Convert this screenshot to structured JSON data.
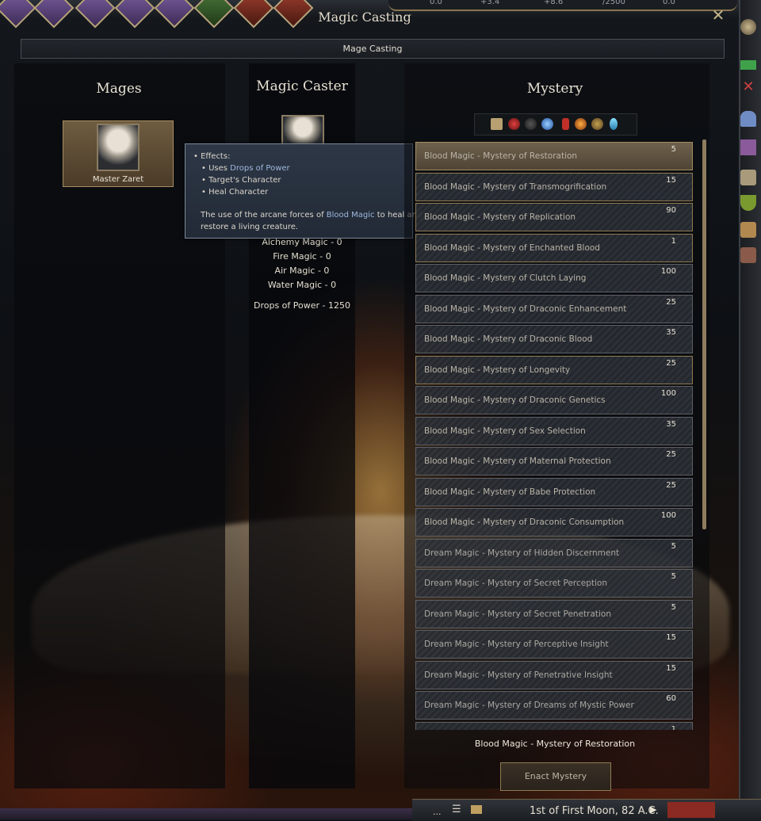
{
  "window": {
    "title": "Magic Casting",
    "subtitle": "Mage Casting",
    "close": "✕"
  },
  "resources": [
    "0.0",
    "+3.4",
    "+8.6",
    "/2500",
    "0.0"
  ],
  "mages": {
    "header": "Mages",
    "list": [
      {
        "name": "Master Zaret"
      }
    ]
  },
  "caster": {
    "header": "Magic Caster",
    "stats": [
      "Alchemy Magic - 0",
      "Fire Magic - 0",
      "Air Magic - 0",
      "Water Magic - 0"
    ],
    "drops": "Drops of Power - 1250"
  },
  "tooltip": {
    "effects_label": "• Effects:",
    "uses_prefix": "• Uses ",
    "uses_value": "Drops of Power",
    "line2": "• Target's Character",
    "line3": "• Heal Character",
    "desc_prefix": "The use of the arcane forces of ",
    "desc_highlight": "Blood Magic",
    "desc_suffix": " to heal and",
    "desc_line2": "restore a living creature."
  },
  "mystery": {
    "header": "Mystery",
    "items": [
      {
        "name": "Blood Magic - Mystery of Restoration",
        "cost": "5"
      },
      {
        "name": "Blood Magic - Mystery of Transmogrification",
        "cost": "15"
      },
      {
        "name": "Blood Magic - Mystery of Replication",
        "cost": "90"
      },
      {
        "name": "Blood Magic - Mystery of Enchanted Blood",
        "cost": "1"
      },
      {
        "name": "Blood Magic - Mystery of Clutch Laying",
        "cost": "100"
      },
      {
        "name": "Blood Magic - Mystery of Draconic Enhancement",
        "cost": "25"
      },
      {
        "name": "Blood Magic - Mystery of Draconic Blood",
        "cost": "35"
      },
      {
        "name": "Blood Magic - Mystery of Longevity",
        "cost": "25"
      },
      {
        "name": "Blood Magic - Mystery of Draconic Genetics",
        "cost": "100"
      },
      {
        "name": "Blood Magic - Mystery of Sex Selection",
        "cost": "35"
      },
      {
        "name": "Blood Magic - Mystery of Maternal Protection",
        "cost": "25"
      },
      {
        "name": "Blood Magic - Mystery of Babe Protection",
        "cost": "25"
      },
      {
        "name": "Blood Magic - Mystery of Draconic Consumption",
        "cost": "100"
      },
      {
        "name": "Dream Magic - Mystery of Hidden Discernment",
        "cost": "5"
      },
      {
        "name": "Dream Magic - Mystery of Secret Perception",
        "cost": "5"
      },
      {
        "name": "Dream Magic - Mystery of Secret Penetration",
        "cost": "5"
      },
      {
        "name": "Dream Magic - Mystery of Perceptive Insight",
        "cost": "15"
      },
      {
        "name": "Dream Magic - Mystery of Penetrative Insight",
        "cost": "15"
      },
      {
        "name": "Dream Magic - Mystery of Dreams of Mystic Power",
        "cost": "60"
      },
      {
        "name": "",
        "cost": "1"
      }
    ],
    "selected": "Blood Magic - Mystery of Restoration",
    "enact_label": "Enact Mystery",
    "school_icons": [
      "book-icon",
      "blood-drop-icon",
      "dark-orb-icon",
      "water-orb-icon",
      "fire-flask-icon",
      "fire-orb-icon",
      "earth-orb-icon",
      "air-crystal-icon"
    ]
  },
  "footer": {
    "menu_dots": "...",
    "date": "1st of First Moon, 82 A.C."
  }
}
